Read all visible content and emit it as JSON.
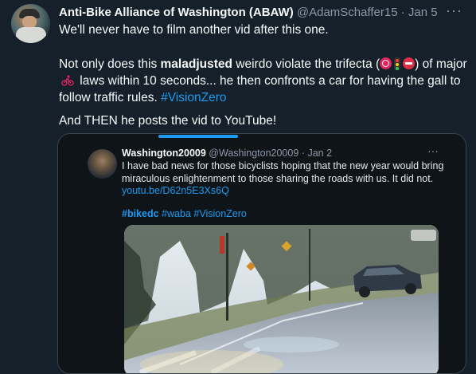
{
  "tweet": {
    "author_name": "Anti-Bike Alliance of Washington (ABAW)",
    "author_handle": "@AdamSchaffer15",
    "separator": "·",
    "date": "Jan 5",
    "more_label": "···",
    "line1": "We'll never have to film another vid after this one.",
    "line2_pre": "Not only does this ",
    "line2_bold": "maladjusted",
    "line2_mid": " weirdo violate the trifecta (",
    "line2_after_emoji": ") of major ",
    "line2_after_bike": " laws within 10 seconds... he then confronts a car for having the gall to follow traffic rules. ",
    "hashtag": "#VisionZero",
    "line4": "And THEN he posts the vid to YouTube!",
    "emojis": [
      "stop-sign-icon",
      "traffic-light-icon",
      "no-entry-icon",
      "cyclist-icon"
    ]
  },
  "embedded": {
    "author_name": "Washington20009",
    "author_handle": "@Washington20009",
    "separator": "·",
    "date": "Jan 2",
    "more_label": "···",
    "text": "I have bad news for those bicyclists hoping that the new year would bring miraculous enlightenment to those sharing the roads with us.  It did not.",
    "link": "youtu.be/D62n5E3Xs6Q",
    "tag1": "#bikedc",
    "tag2": "#waba",
    "tag3": "#VisionZero"
  },
  "colors": {
    "background": "#15202b",
    "link": "#1d9bf0",
    "muted": "#8b98a5"
  }
}
